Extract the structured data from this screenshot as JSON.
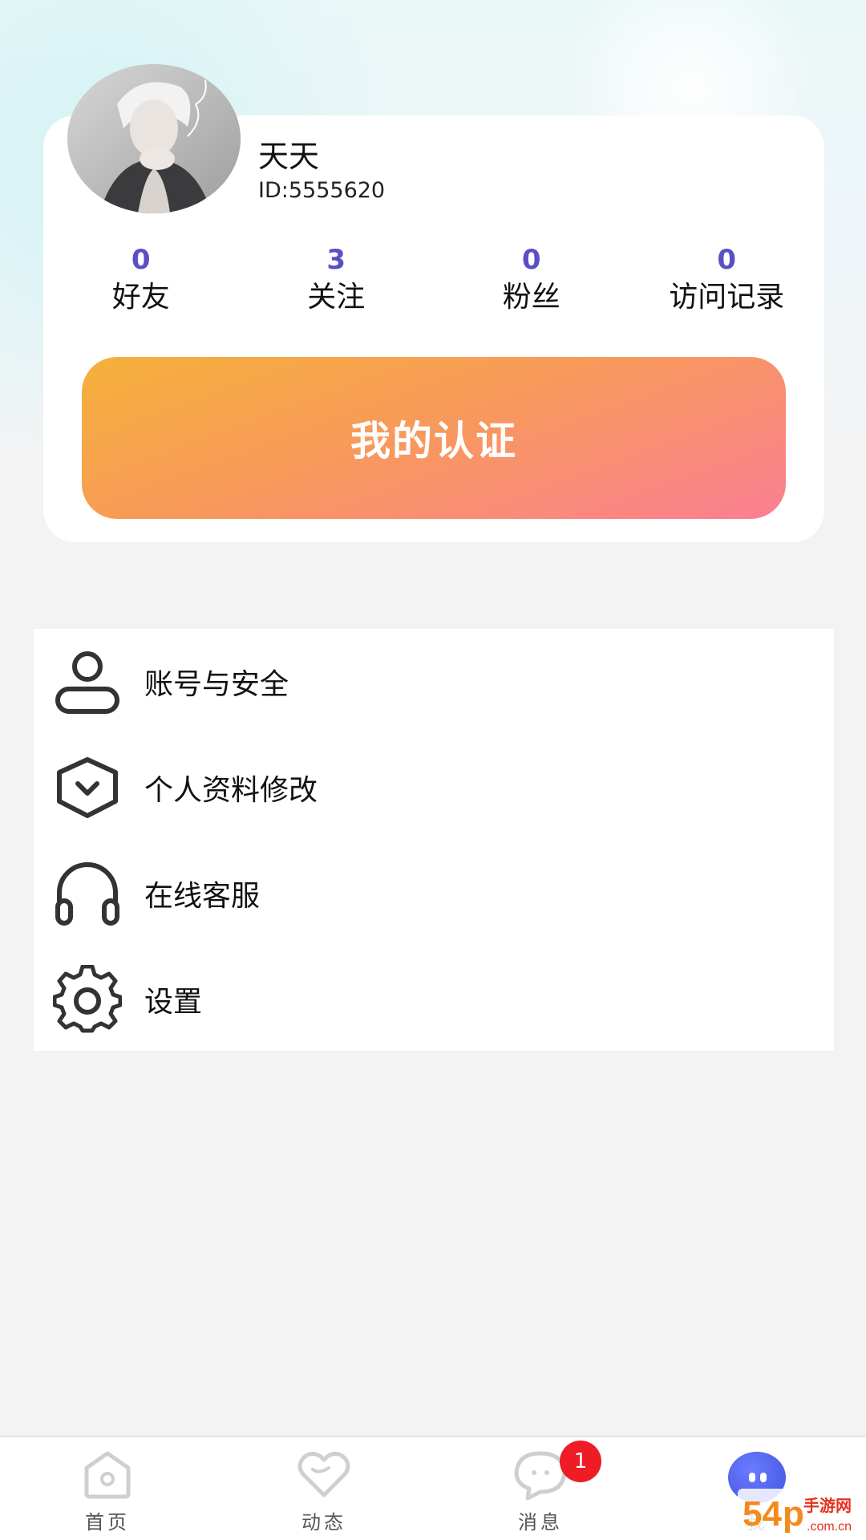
{
  "profile": {
    "username": "天天",
    "id_text": "ID:5555620",
    "stats": [
      {
        "value": "0",
        "label": "好友"
      },
      {
        "value": "3",
        "label": "关注"
      },
      {
        "value": "0",
        "label": "粉丝"
      },
      {
        "value": "0",
        "label": "访问记录"
      }
    ],
    "cert_button_label": "我的认证"
  },
  "menu": {
    "items": [
      {
        "label": "账号与安全",
        "icon": "user-icon"
      },
      {
        "label": "个人资料修改",
        "icon": "profile-edit-icon"
      },
      {
        "label": "在线客服",
        "icon": "headphones-icon"
      },
      {
        "label": "设置",
        "icon": "gear-icon"
      }
    ]
  },
  "tab_bar": {
    "tabs": [
      {
        "label": "首页",
        "icon": "home-icon"
      },
      {
        "label": "动态",
        "icon": "heart-icon"
      },
      {
        "label": "消息",
        "icon": "chat-icon",
        "badge": "1"
      },
      {
        "label": "我",
        "icon": "me-icon"
      }
    ]
  },
  "watermark": {
    "text": "54p手游网 .com.cn"
  },
  "colors": {
    "accent_purple": "#5a4fc4",
    "cert_gradient_start": "#f6b13a",
    "cert_gradient_end": "#fb7f93",
    "badge_red": "#ee1c25",
    "me_icon_blue": "#4e5fe8"
  }
}
